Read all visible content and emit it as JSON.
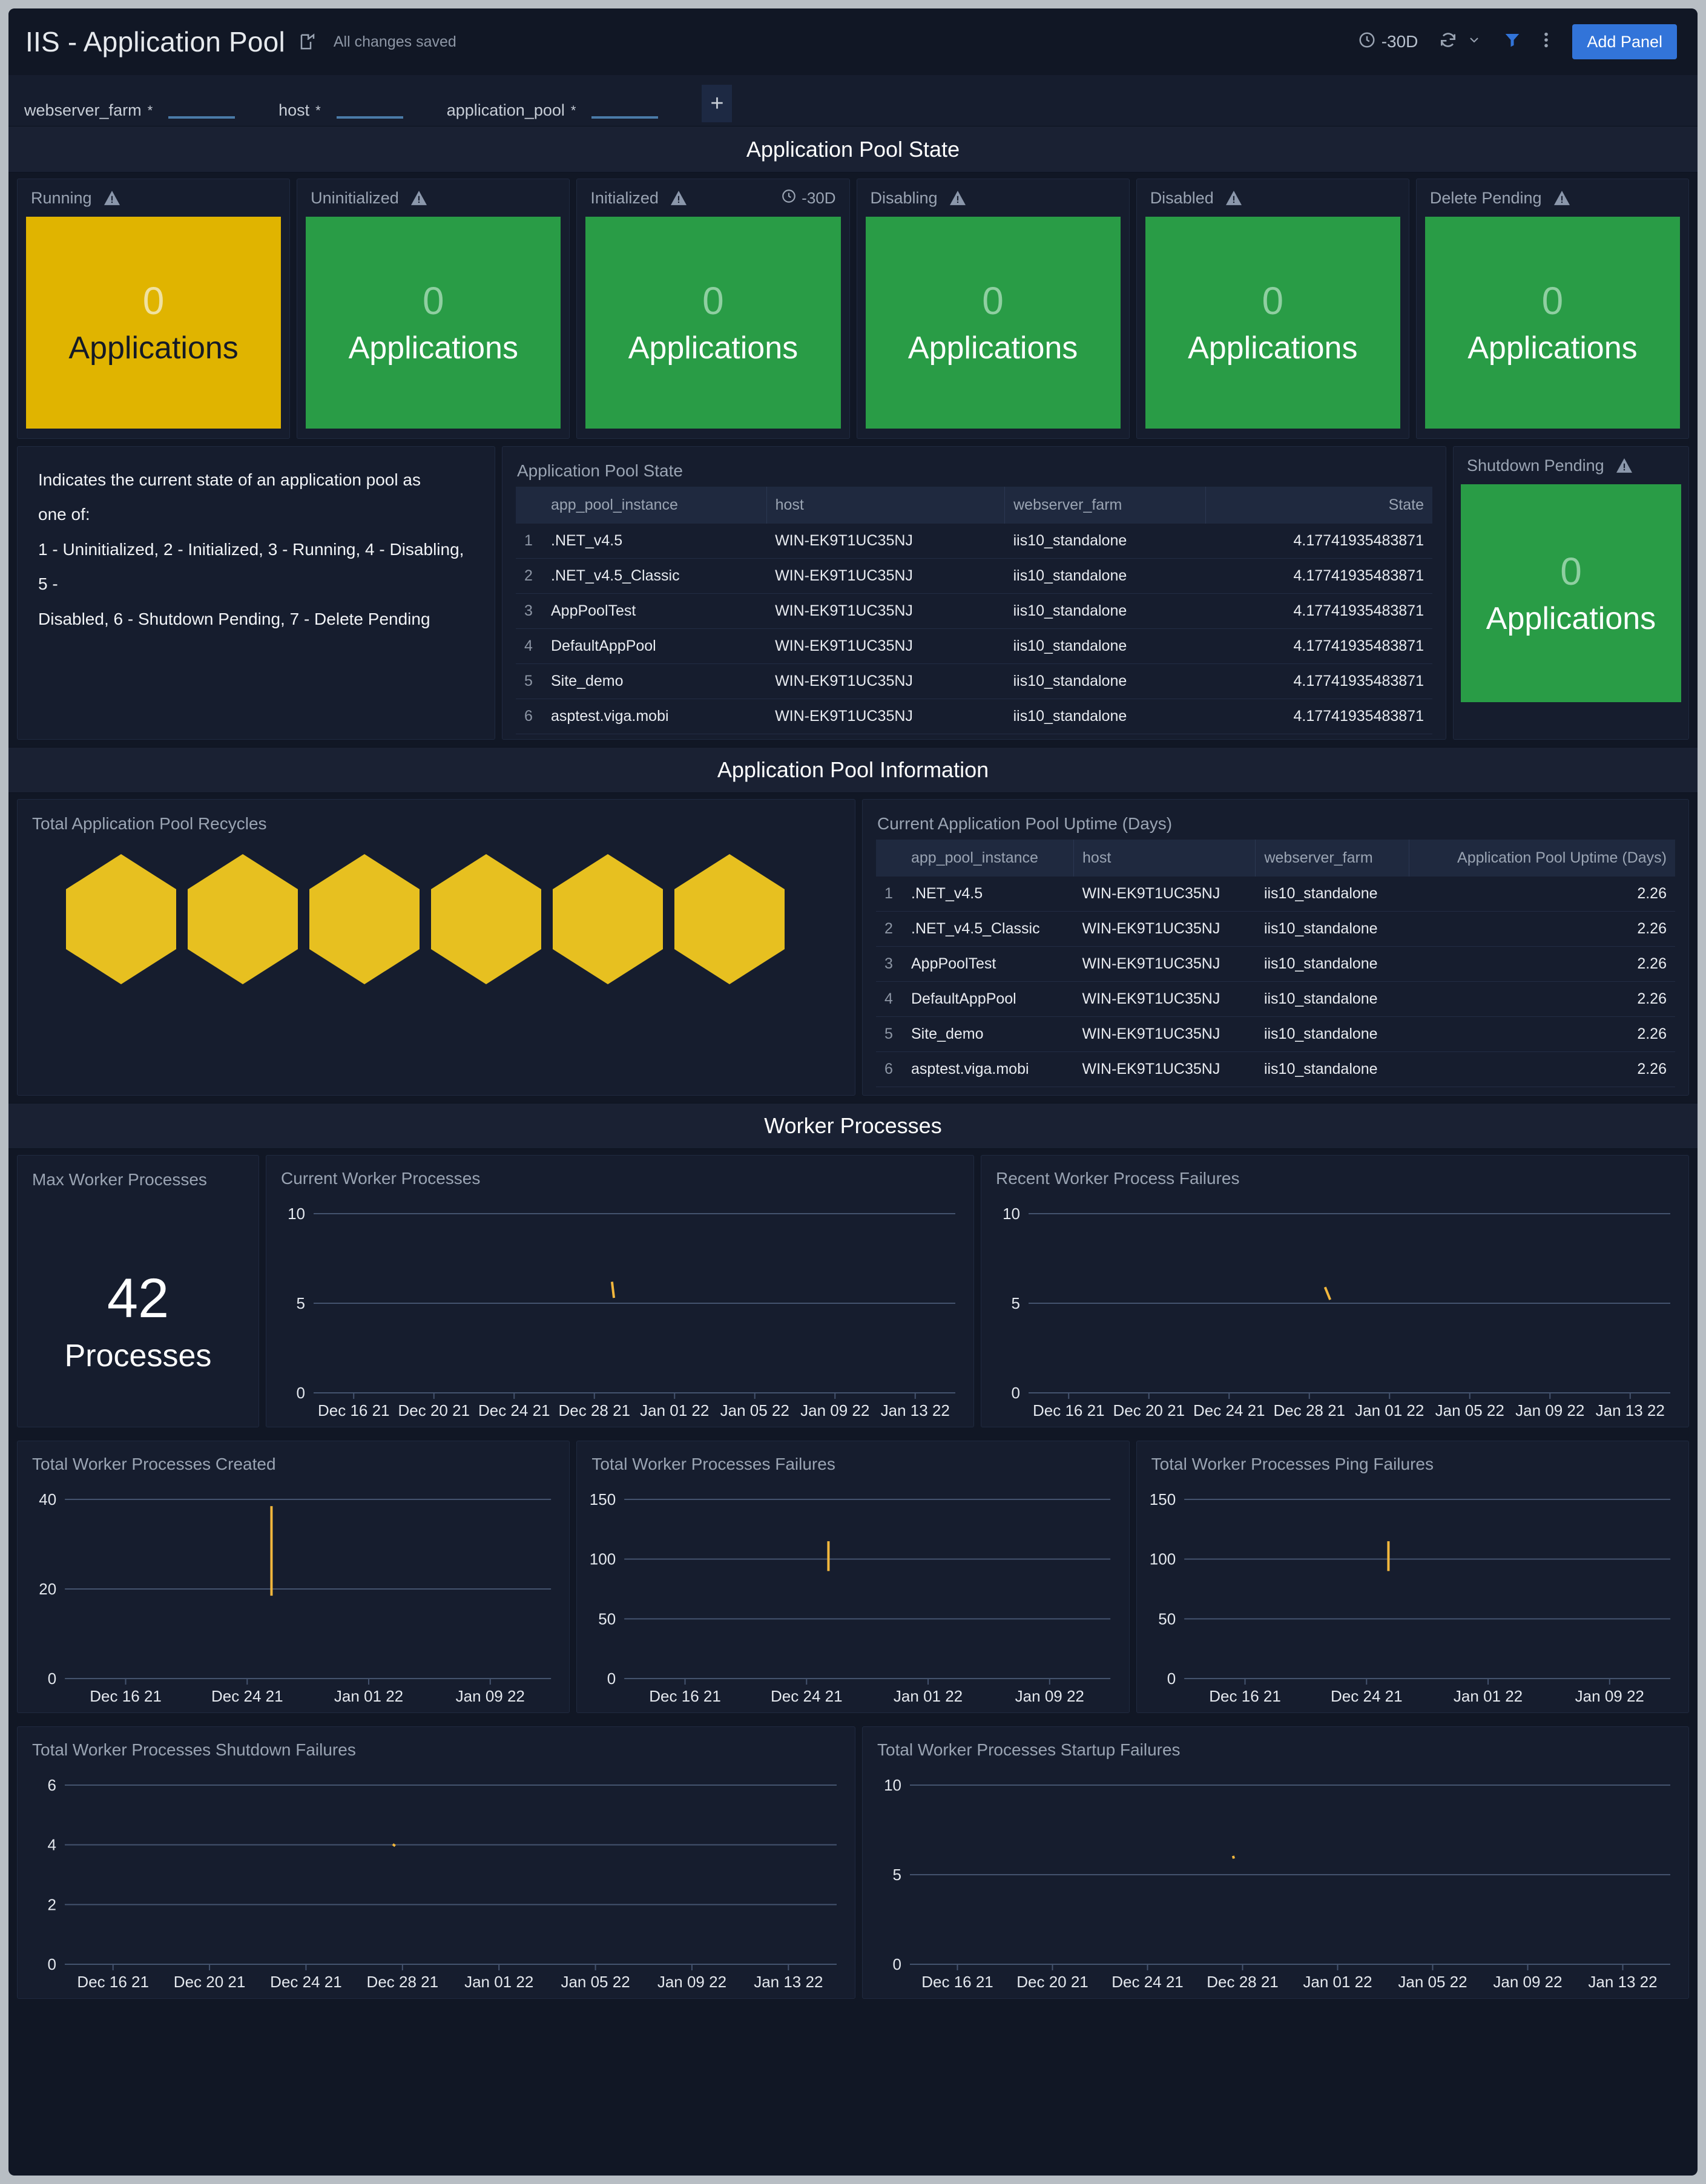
{
  "header": {
    "title": "IIS - Application Pool",
    "share_icon": "share-icon",
    "saved_text": "All changes saved",
    "time_range": "-30D",
    "clock_icon": "clock-icon",
    "refresh_icon": "refresh-icon",
    "chevron_icon": "chevron-down-icon",
    "filter_icon": "filter-icon",
    "more_icon": "more-vertical-icon",
    "add_panel_label": "Add Panel",
    "accent_blue": "#3274d9"
  },
  "variables": [
    {
      "name": "webserver_farm",
      "star": "*",
      "value": ""
    },
    {
      "name": "host",
      "star": "*",
      "value": ""
    },
    {
      "name": "application_pool",
      "star": "*",
      "value": ""
    }
  ],
  "variables_add_label": "+",
  "sections": {
    "state": "Application Pool State",
    "information": "Application Pool Information",
    "worker": "Worker Processes"
  },
  "state_panels": [
    {
      "title": "Running",
      "value": "0",
      "unit": "Applications",
      "color": "#e0b400",
      "theme": "yellow",
      "warn_icon": "warning-triangle-icon"
    },
    {
      "title": "Uninitialized",
      "value": "0",
      "unit": "Applications",
      "color": "#299c46",
      "theme": "green",
      "warn_icon": "warning-triangle-icon"
    },
    {
      "title": "Initialized",
      "value": "0",
      "unit": "Applications",
      "color": "#299c46",
      "theme": "green",
      "warn_icon": "warning-triangle-icon",
      "time_override": "-30D"
    },
    {
      "title": "Disabling",
      "value": "0",
      "unit": "Applications",
      "color": "#299c46",
      "theme": "green",
      "warn_icon": "warning-triangle-icon"
    },
    {
      "title": "Disabled",
      "value": "0",
      "unit": "Applications",
      "color": "#299c46",
      "theme": "green",
      "warn_icon": "warning-triangle-icon"
    },
    {
      "title": "Delete Pending",
      "value": "0",
      "unit": "Applications",
      "color": "#299c46",
      "theme": "green",
      "warn_icon": "warning-triangle-icon"
    }
  ],
  "description_panel": {
    "line1": "Indicates the current state of an application pool as",
    "line2": "one of:",
    "line3": "1 - Uninitialized, 2 - Initialized, 3 - Running, 4 - Disabling, 5 -",
    "line4": "Disabled, 6 - Shutdown Pending, 7 - Delete Pending"
  },
  "state_table": {
    "title": "Application Pool State",
    "columns": [
      "app_pool_instance",
      "host",
      "webserver_farm",
      "State"
    ],
    "rows": [
      {
        "idx": "1",
        "app_pool_instance": ".NET_v4.5",
        "host": "WIN-EK9T1UC35NJ",
        "webserver_farm": "iis10_standalone",
        "state": "4.17741935483871"
      },
      {
        "idx": "2",
        "app_pool_instance": ".NET_v4.5_Classic",
        "host": "WIN-EK9T1UC35NJ",
        "webserver_farm": "iis10_standalone",
        "state": "4.17741935483871"
      },
      {
        "idx": "3",
        "app_pool_instance": "AppPoolTest",
        "host": "WIN-EK9T1UC35NJ",
        "webserver_farm": "iis10_standalone",
        "state": "4.17741935483871"
      },
      {
        "idx": "4",
        "app_pool_instance": "DefaultAppPool",
        "host": "WIN-EK9T1UC35NJ",
        "webserver_farm": "iis10_standalone",
        "state": "4.17741935483871"
      },
      {
        "idx": "5",
        "app_pool_instance": "Site_demo",
        "host": "WIN-EK9T1UC35NJ",
        "webserver_farm": "iis10_standalone",
        "state": "4.17741935483871"
      },
      {
        "idx": "6",
        "app_pool_instance": "asptest.viga.mobi",
        "host": "WIN-EK9T1UC35NJ",
        "webserver_farm": "iis10_standalone",
        "state": "4.17741935483871"
      }
    ]
  },
  "shutdown_pending": {
    "title": "Shutdown Pending",
    "value": "0",
    "unit": "Applications",
    "color": "#299c46",
    "warn_icon": "warning-triangle-icon"
  },
  "recycles_panel": {
    "title": "Total Application Pool Recycles",
    "hexagon_count": 6,
    "hexagon_color": "#e7c020"
  },
  "uptime_table": {
    "title": "Current Application Pool Uptime (Days)",
    "columns": [
      "app_pool_instance",
      "host",
      "webserver_farm",
      "Application Pool Uptime (Days)"
    ],
    "rows": [
      {
        "idx": "1",
        "app_pool_instance": ".NET_v4.5",
        "host": "WIN-EK9T1UC35NJ",
        "webserver_farm": "iis10_standalone",
        "uptime": "2.26"
      },
      {
        "idx": "2",
        "app_pool_instance": ".NET_v4.5_Classic",
        "host": "WIN-EK9T1UC35NJ",
        "webserver_farm": "iis10_standalone",
        "uptime": "2.26"
      },
      {
        "idx": "3",
        "app_pool_instance": "AppPoolTest",
        "host": "WIN-EK9T1UC35NJ",
        "webserver_farm": "iis10_standalone",
        "uptime": "2.26"
      },
      {
        "idx": "4",
        "app_pool_instance": "DefaultAppPool",
        "host": "WIN-EK9T1UC35NJ",
        "webserver_farm": "iis10_standalone",
        "uptime": "2.26"
      },
      {
        "idx": "5",
        "app_pool_instance": "Site_demo",
        "host": "WIN-EK9T1UC35NJ",
        "webserver_farm": "iis10_standalone",
        "uptime": "2.26"
      },
      {
        "idx": "6",
        "app_pool_instance": "asptest.viga.mobi",
        "host": "WIN-EK9T1UC35NJ",
        "webserver_farm": "iis10_standalone",
        "uptime": "2.26"
      }
    ]
  },
  "max_worker_processes": {
    "title": "Max Worker Processes",
    "value": "42",
    "unit": "Processes"
  },
  "chart_data": [
    {
      "id": "current_worker_processes",
      "type": "line",
      "title": "Current Worker Processes",
      "xlabel": "",
      "ylabel": "",
      "ylim": [
        0,
        10
      ],
      "yticks": [
        0,
        5,
        10
      ],
      "ytick_labels": [
        "0",
        "5",
        "10"
      ],
      "xtick_labels": [
        "Dec 16 21",
        "Dec 20 21",
        "Dec 24 21",
        "Dec 28 21",
        "Jan 01 22",
        "Jan 05 22",
        "Jan 09 22",
        "Jan 13 22"
      ],
      "grid": true,
      "series": [
        {
          "name": "worker processes",
          "color": "#f2b73d",
          "points": [
            {
              "x": 0.465,
              "y": 6.2
            },
            {
              "x": 0.468,
              "y": 5.3
            }
          ]
        }
      ]
    },
    {
      "id": "recent_worker_process_failures",
      "type": "line",
      "title": "Recent Worker Process Failures",
      "xlabel": "",
      "ylabel": "",
      "ylim": [
        0,
        10
      ],
      "yticks": [
        0,
        5,
        10
      ],
      "ytick_labels": [
        "0",
        "5",
        "10"
      ],
      "xtick_labels": [
        "Dec 16 21",
        "Dec 20 21",
        "Dec 24 21",
        "Dec 28 21",
        "Jan 01 22",
        "Jan 05 22",
        "Jan 09 22",
        "Jan 13 22"
      ],
      "grid": true,
      "series": [
        {
          "name": "failures",
          "color": "#f2b73d",
          "points": [
            {
              "x": 0.462,
              "y": 5.9
            },
            {
              "x": 0.47,
              "y": 5.2
            }
          ]
        }
      ]
    },
    {
      "id": "total_worker_processes_created",
      "type": "line",
      "title": "Total Worker Processes Created",
      "xlabel": "",
      "ylabel": "",
      "ylim": [
        0,
        40
      ],
      "yticks": [
        0,
        20,
        40
      ],
      "ytick_labels": [
        "0",
        "20",
        "40"
      ],
      "xtick_labels": [
        "Dec 16 21",
        "Dec 24 21",
        "Jan 01 22",
        "Jan 09 22"
      ],
      "grid": true,
      "series": [
        {
          "name": "created",
          "color": "#f2b73d",
          "points": [
            {
              "x": 0.425,
              "y": 38.5
            },
            {
              "x": 0.425,
              "y": 18.5
            }
          ]
        }
      ]
    },
    {
      "id": "total_worker_processes_failures",
      "type": "line",
      "title": "Total Worker Processes Failures",
      "xlabel": "",
      "ylabel": "",
      "ylim": [
        0,
        150
      ],
      "yticks": [
        0,
        50,
        100,
        150
      ],
      "ytick_labels": [
        "0",
        "50",
        "100",
        "150"
      ],
      "xtick_labels": [
        "Dec 16 21",
        "Dec 24 21",
        "Jan 01 22",
        "Jan 09 22"
      ],
      "grid": true,
      "series": [
        {
          "name": "failures",
          "color": "#f2b73d",
          "points": [
            {
              "x": 0.42,
              "y": 115
            },
            {
              "x": 0.42,
              "y": 90
            }
          ]
        }
      ]
    },
    {
      "id": "total_worker_processes_ping_failures",
      "type": "line",
      "title": "Total Worker Processes Ping Failures",
      "xlabel": "",
      "ylabel": "",
      "ylim": [
        0,
        150
      ],
      "yticks": [
        0,
        50,
        100,
        150
      ],
      "ytick_labels": [
        "0",
        "50",
        "100",
        "150"
      ],
      "xtick_labels": [
        "Dec 16 21",
        "Dec 24 21",
        "Jan 01 22",
        "Jan 09 22"
      ],
      "grid": true,
      "series": [
        {
          "name": "ping failures",
          "color": "#f2b73d",
          "points": [
            {
              "x": 0.42,
              "y": 115
            },
            {
              "x": 0.42,
              "y": 90
            }
          ]
        }
      ]
    },
    {
      "id": "total_worker_processes_shutdown_failures",
      "type": "line",
      "title": "Total Worker Processes Shutdown Failures",
      "xlabel": "",
      "ylabel": "",
      "ylim": [
        0,
        6
      ],
      "yticks": [
        0,
        2,
        4,
        6
      ],
      "ytick_labels": [
        "0",
        "2",
        "4",
        "6"
      ],
      "xtick_labels": [
        "Dec 16 21",
        "Dec 20 21",
        "Dec 24 21",
        "Dec 28 21",
        "Jan 01 22",
        "Jan 05 22",
        "Jan 09 22",
        "Jan 13 22"
      ],
      "grid": true,
      "series": [
        {
          "name": "shutdown failures",
          "color": "#f2b73d",
          "points": [
            {
              "x": 0.425,
              "y": 4.02
            },
            {
              "x": 0.428,
              "y": 3.96
            }
          ]
        }
      ]
    },
    {
      "id": "total_worker_processes_startup_failures",
      "type": "line",
      "title": "Total Worker Processes Startup Failures",
      "xlabel": "",
      "ylabel": "",
      "ylim": [
        0,
        10
      ],
      "yticks": [
        0,
        5,
        10
      ],
      "ytick_labels": [
        "0",
        "5",
        "10"
      ],
      "xtick_labels": [
        "Dec 16 21",
        "Dec 20 21",
        "Dec 24 21",
        "Dec 28 21",
        "Jan 01 22",
        "Jan 05 22",
        "Jan 09 22",
        "Jan 13 22"
      ],
      "grid": true,
      "series": [
        {
          "name": "startup failures",
          "color": "#f2b73d",
          "points": [
            {
              "x": 0.425,
              "y": 6.05
            },
            {
              "x": 0.426,
              "y": 5.9
            }
          ]
        }
      ]
    }
  ]
}
